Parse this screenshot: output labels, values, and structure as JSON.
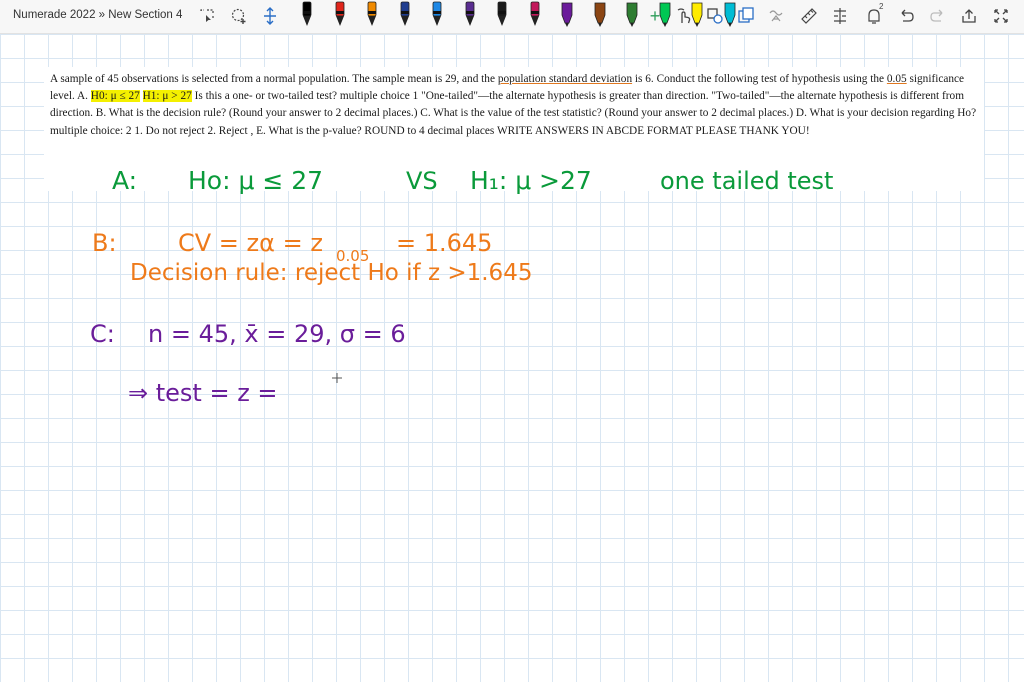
{
  "window": {
    "title": "Numerade 2022 » New Section 4"
  },
  "toolbar": {
    "pen_colors": [
      "#000000",
      "#e1251b",
      "#f08a00",
      "#1f3d8f",
      "#1e88e5",
      "#5a2d91",
      "#1a1a1a",
      "#c2185b",
      "#6a1b9a",
      "#8b4513",
      "#2e7d32",
      "#00c853",
      "#ffeb00",
      "#00bcd4"
    ],
    "icons": [
      "lasso-select-icon",
      "add-space-icon",
      "pen-icon",
      "marker-icon",
      "plus-icon",
      "finger-draw-icon",
      "shapes-icon",
      "convert-icon",
      "ink-to-math-icon",
      "ruler-icon",
      "insert-space-icon",
      "notification-icon",
      "undo-icon",
      "redo-icon",
      "share-icon",
      "fullscreen-icon"
    ],
    "notification_count": "2"
  },
  "question": {
    "part1": "A sample of 45 observations is selected from a normal population. The sample mean is 29, and the ",
    "underline1": "population standard deviation",
    "part2": " is 6. Conduct the following test of hypothesis using the ",
    "underline2": "0.05",
    "part3": " significance level. A. ",
    "highlight1": "H0: μ ≤ 27",
    "space": " ",
    "highlight2": "H1: μ > 27",
    "part4": " Is this a one- or two-tailed test? multiple choice 1 \"One-tailed\"—the alternate hypothesis is greater than direction. \"Two-tailed\"—the alternate hypothesis is different from direction. B. What is the decision rule? (Round your answer to 2 decimal places.) C. What is the value of the test statistic? (Round your answer to 2 decimal places.) D. What is your decision regarding Ho? multiple choice: 2 1. Do not reject 2. Reject , E. What is the p-value? ROUND to 4 decimal places WRITE ANSWERS IN ABCDE FORMAT PLEASE THANK YOU!"
  },
  "handwriting": {
    "lineA": {
      "label": "A:",
      "h0": "Ho: μ ≤ 27",
      "vs": "VS",
      "h1": "H₁: μ >27",
      "note": "one tailed test"
    },
    "lineB1": {
      "label": "B:",
      "text": "CV = zα = z",
      "sub": "0.05",
      "value": "= 1.645"
    },
    "lineB2": {
      "text": "Decision rule: reject Ho if z >1.645"
    },
    "lineC": {
      "label": "C:",
      "text": "n = 45,  x̄ = 29,  σ = 6"
    },
    "lineD": {
      "text": "⇒ test = z ="
    }
  }
}
